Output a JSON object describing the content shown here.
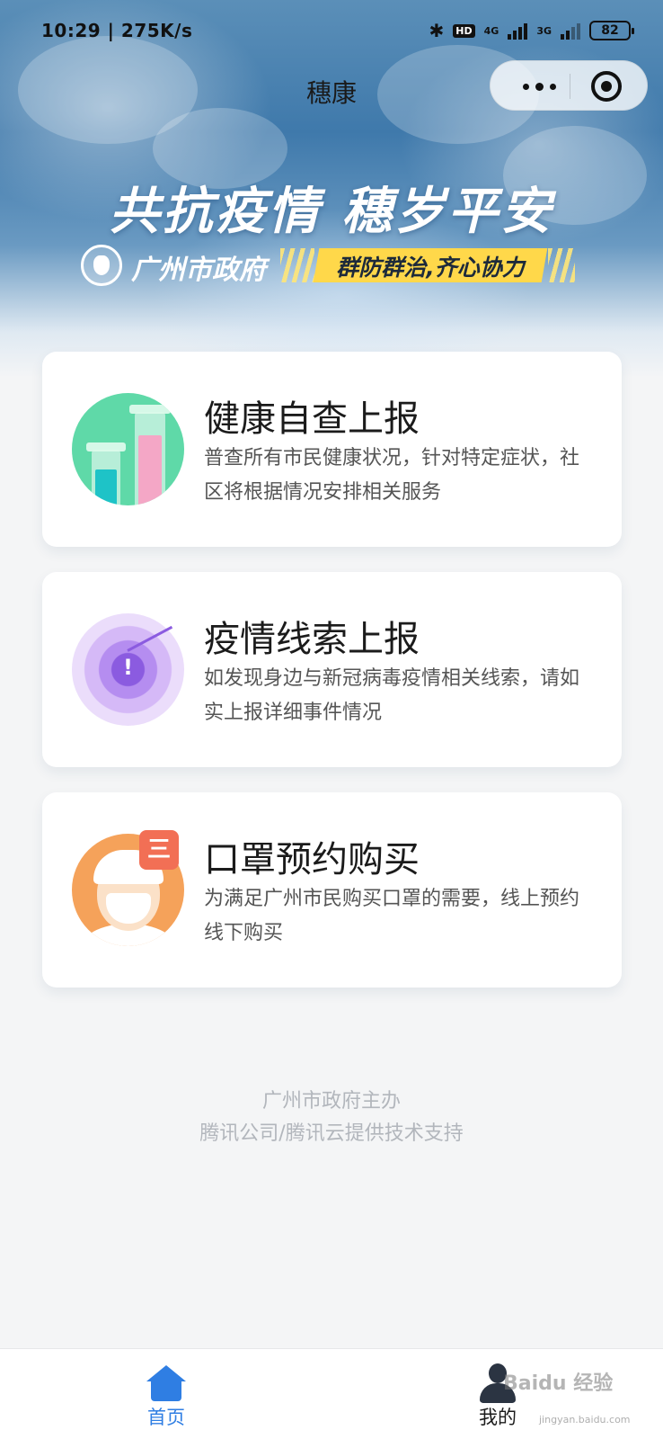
{
  "status_bar": {
    "time": "10:29",
    "network_speed": "275K/s",
    "hd_badge": "HD",
    "signal_1": "4G",
    "signal_2": "3G",
    "battery": "82"
  },
  "nav": {
    "title": "穗康"
  },
  "banner": {
    "slogan": "共抗疫情 穗岁平安",
    "org": "广州市政府",
    "motto": "群防群治,齐心协力"
  },
  "cards": [
    {
      "title": "健康自查上报",
      "desc": "普查所有市民健康状况，针对特定症状，社区将根据情况安排相关服务",
      "icon": "test-tube-icon"
    },
    {
      "title": "疫情线索上报",
      "desc": "如发现身边与新冠病毒疫情相关线索，请如实上报详细事件情况",
      "icon": "radar-alert-icon",
      "icon_mark": "!"
    },
    {
      "title": "口罩预约购买",
      "desc": "为满足广州市民购买口罩的需要，线上预约线下购买",
      "icon": "mask-person-icon",
      "icon_badge": "三"
    }
  ],
  "credits": {
    "line1": "广州市政府主办",
    "line2": "腾讯公司/腾讯云提供技术支持"
  },
  "tabbar": {
    "home_label": "首页",
    "mine_label": "我的",
    "active": "home",
    "active_color": "#2f7ee3"
  },
  "watermark": {
    "text": "Baidu 经验",
    "sub": "jingyan.baidu.com"
  },
  "colors": {
    "health_icon": "#5fd9a8",
    "clue_icon": "#8b5be0",
    "mask_icon": "#f5a25a",
    "motto_bg": "#ffd84a"
  }
}
